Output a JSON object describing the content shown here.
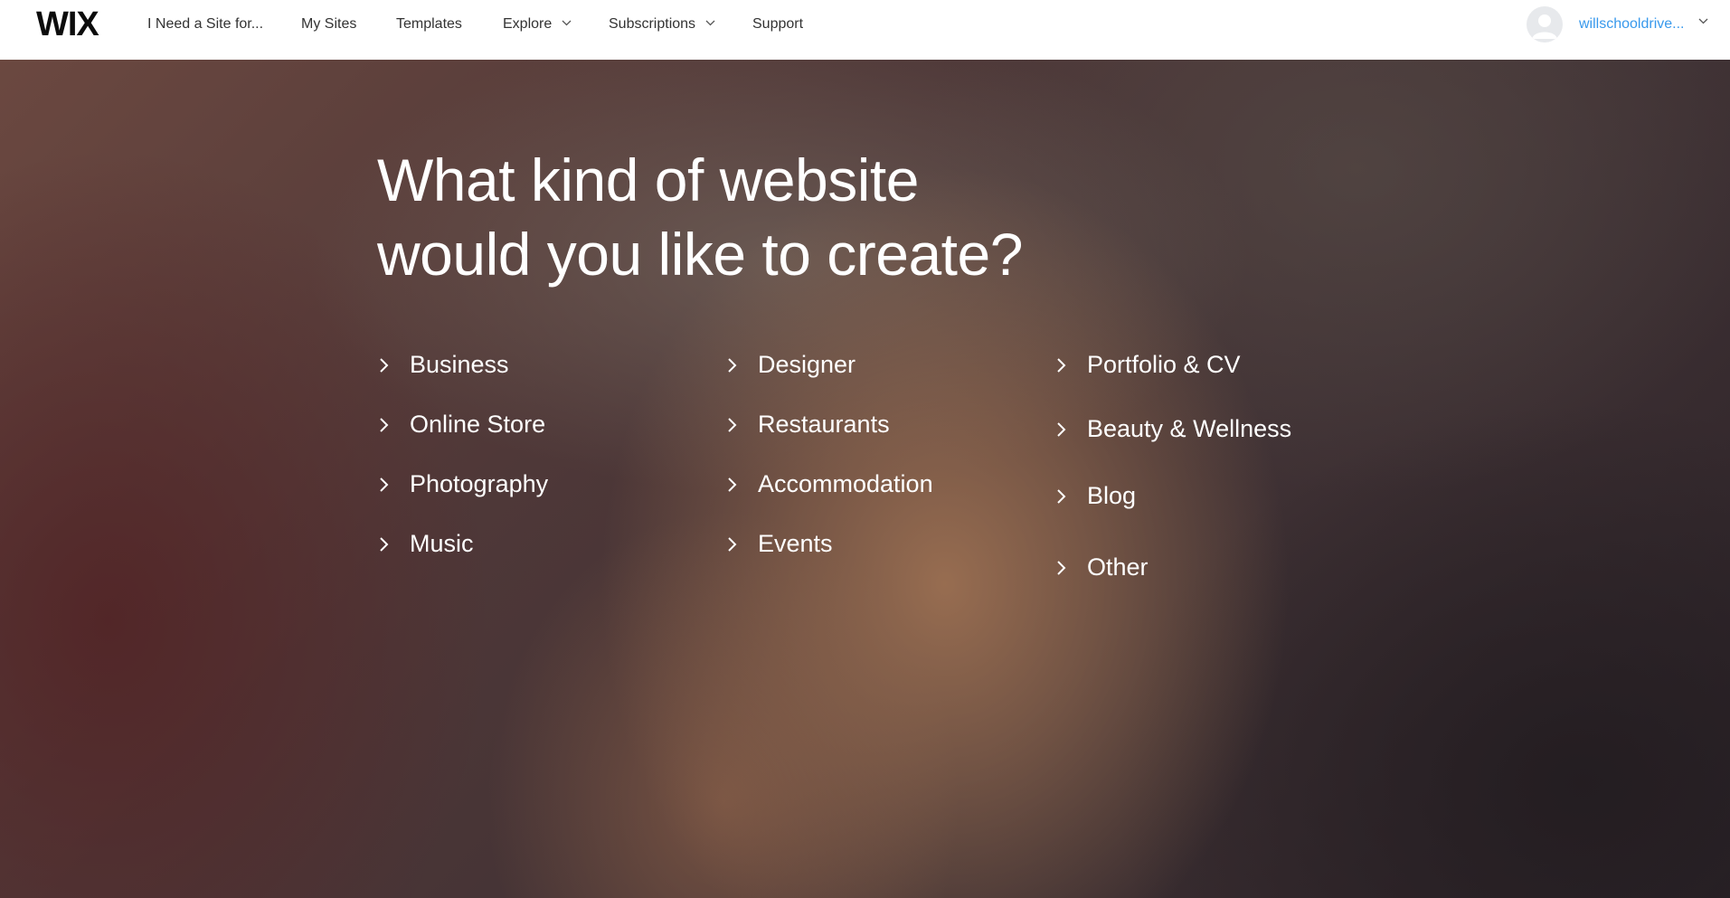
{
  "header": {
    "logo": "WIX",
    "nav": [
      {
        "label": "I Need a Site for...",
        "dropdown": false
      },
      {
        "label": "My Sites",
        "dropdown": false
      },
      {
        "label": "Templates",
        "dropdown": false
      },
      {
        "label": "Explore",
        "dropdown": true
      },
      {
        "label": "Subscriptions",
        "dropdown": true
      },
      {
        "label": "Support",
        "dropdown": false
      }
    ],
    "user": {
      "name": "willschooldrive...",
      "avatar_icon": "user-avatar-icon"
    }
  },
  "hero": {
    "headline_line1": "What kind of website",
    "headline_line2": "would you like to create?",
    "columns": [
      [
        "Business",
        "Online Store",
        "Photography",
        "Music"
      ],
      [
        "Designer",
        "Restaurants",
        "Accommodation",
        "Events"
      ],
      [
        "Portfolio & CV",
        "Beauty & Wellness",
        "Blog",
        "Other"
      ]
    ],
    "option_icon": "chevron-right-icon"
  },
  "colors": {
    "nav_text": "#333333",
    "user_link": "#3899ec",
    "hero_text": "#ffffff"
  }
}
